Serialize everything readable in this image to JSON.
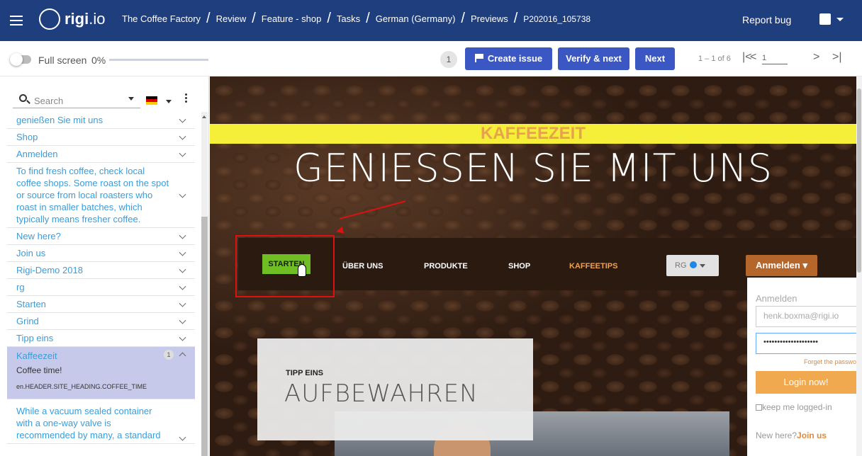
{
  "header": {
    "logo_name": "rigi",
    "logo_tld": ".io",
    "breadcrumbs": [
      "The Coffee Factory",
      "Review",
      "Feature - shop",
      "Tasks",
      "German (Germany)",
      "Previews",
      "P202016_105738"
    ],
    "report_bug": "Report bug"
  },
  "toolbar": {
    "fullscreen_label": "Full screen",
    "progress_text": "0%",
    "progress_value": 0,
    "issue_count": "1",
    "create_issue": "Create issue",
    "verify_next": "Verify & next",
    "next": "Next",
    "pager_text": "1 – 1 of 6",
    "page_input": "1",
    "first": "|<",
    "prev": "<",
    "next_page": ">",
    "last": ">|"
  },
  "sidebar": {
    "search_placeholder": "Search",
    "items": [
      {
        "label": "genießen Sie mit uns"
      },
      {
        "label": "Shop"
      },
      {
        "label": "Anmelden"
      },
      {
        "label": "To find fresh coffee, check local coffee shops. Some roast on the spot or source from local roasters who roast in smaller batches, which typically means fresher coffee."
      },
      {
        "label": "New here?"
      },
      {
        "label": "Join us"
      },
      {
        "label": "Rigi-Demo 2018"
      },
      {
        "label": "rg"
      },
      {
        "label": "Starten"
      },
      {
        "label": "Grind"
      },
      {
        "label": "Tipp eins"
      }
    ],
    "active": {
      "title": "Kaffeezeit",
      "badge": "1",
      "text": "Coffee time!",
      "key": "en.HEADER.SITE_HEADING.COFFEE_TIME"
    },
    "last_item": "While a vacuum sealed container with a one-way valve is recommended by many, a standard"
  },
  "preview": {
    "banner": "KAFFEEZEIT",
    "hero": "GENIESSEN SIE MIT UNS",
    "nav": {
      "starten": "STARTEN",
      "ueber_uns": "ÜBER UNS",
      "produkte": "PRODUKTE",
      "shop": "SHOP",
      "kaffeetips": "KAFFEETIPS",
      "rg": "RG",
      "anmelden": "Anmelden"
    },
    "login": {
      "title": "Anmelden",
      "email": "henk.boxma@rigi.io",
      "password": "••••••••••••••••••••",
      "forgot": "Forget the passwo",
      "login_now": "Login now!",
      "keep": "keep me logged-in",
      "new_here": "New here?",
      "join": "Join us"
    },
    "tip_small": "TIPP EINS",
    "tip_big": "AUFBEWAHREN"
  },
  "colors": {
    "header_bg": "#1e3e7e",
    "button_blue": "#3b57c4",
    "link_blue": "#3a9dda",
    "starten_green": "#6fbe24",
    "highlight_red": "#dd1111",
    "banner_yellow": "#f5ef3a"
  }
}
